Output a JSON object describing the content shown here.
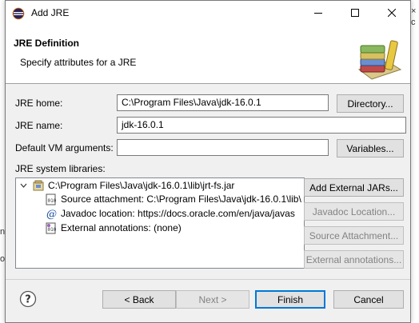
{
  "window": {
    "title": "Add JRE"
  },
  "header": {
    "title": "JRE Definition",
    "description": "Specify attributes for a JRE"
  },
  "form": {
    "jre_home_label": "JRE home:",
    "jre_home_value": "C:\\Program Files\\Java\\jdk-16.0.1",
    "directory_button": "Directory...",
    "jre_name_label": "JRE name:",
    "jre_name_value": "jdk-16.0.1",
    "vm_args_label": "Default VM arguments:",
    "vm_args_value": "",
    "variables_button": "Variables...",
    "libraries_label": "JRE system libraries:"
  },
  "tree": {
    "root": "C:\\Program Files\\Java\\jdk-16.0.1\\lib\\jrt-fs.jar",
    "children": [
      "Source attachment: C:\\Program Files\\Java\\jdk-16.0.1\\lib\\",
      "Javadoc location: https://docs.oracle.com/en/java/javas",
      "External annotations: (none)"
    ]
  },
  "side_buttons": {
    "add_external_jars": "Add External JARs...",
    "javadoc_location": "Javadoc Location...",
    "source_attachment": "Source Attachment...",
    "external_annotations": "External annotations..."
  },
  "footer": {
    "back": "< Back",
    "next": "Next >",
    "finish": "Finish",
    "cancel": "Cancel"
  },
  "background": {
    "right_fragments": [
      "×",
      "c",
      "ı"
    ],
    "left_fragments": [
      "n",
      "or"
    ]
  }
}
